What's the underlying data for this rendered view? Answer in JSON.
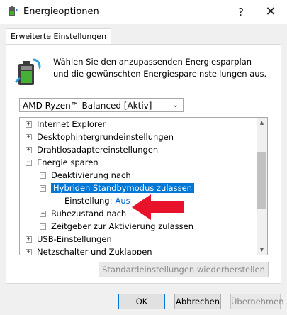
{
  "window": {
    "title": "Energieoptionen",
    "help_glyph": "?",
    "close_glyph": "✕"
  },
  "tabs": [
    {
      "label": "Erweiterte Einstellungen"
    }
  ],
  "description": "Wählen Sie den anzupassenden Energiesparplan und die gewünschten Energiespareinstellungen aus.",
  "plan_select": {
    "value": "AMD Ryzen™ Balanced [Aktiv]",
    "arrow_glyph": "⌄"
  },
  "tree": {
    "items": [
      {
        "label": "Internet Explorer",
        "expander": "+"
      },
      {
        "label": "Desktophintergrundeinstellungen",
        "expander": "+"
      },
      {
        "label": "Drahtlosadaptereinstellungen",
        "expander": "+"
      },
      {
        "label": "Energie sparen",
        "expander": "−"
      },
      {
        "label": "Deaktivierung nach",
        "expander": "+"
      },
      {
        "label": "Hybriden Standbymodus zulassen",
        "expander": "−"
      },
      {
        "label": "Einstellung:",
        "value": "Aus"
      },
      {
        "label": "Ruhezustand nach",
        "expander": "+"
      },
      {
        "label": "Zeitgeber zur Aktivierung zulassen",
        "expander": "+"
      },
      {
        "label": "USB-Einstellungen",
        "expander": "+"
      },
      {
        "label": "Netzschalter und Zuklappen",
        "expander": "+"
      }
    ],
    "scroll_up_glyph": "▲",
    "scroll_down_glyph": "▼"
  },
  "buttons": {
    "restore": "Standardeinstellungen wiederherstellen",
    "ok": "OK",
    "cancel": "Abbrechen",
    "apply": "Übernehmen"
  },
  "colors": {
    "selection": "#0078d7",
    "setting_value": "#0066cc",
    "annotation_arrow": "#e8132a"
  }
}
